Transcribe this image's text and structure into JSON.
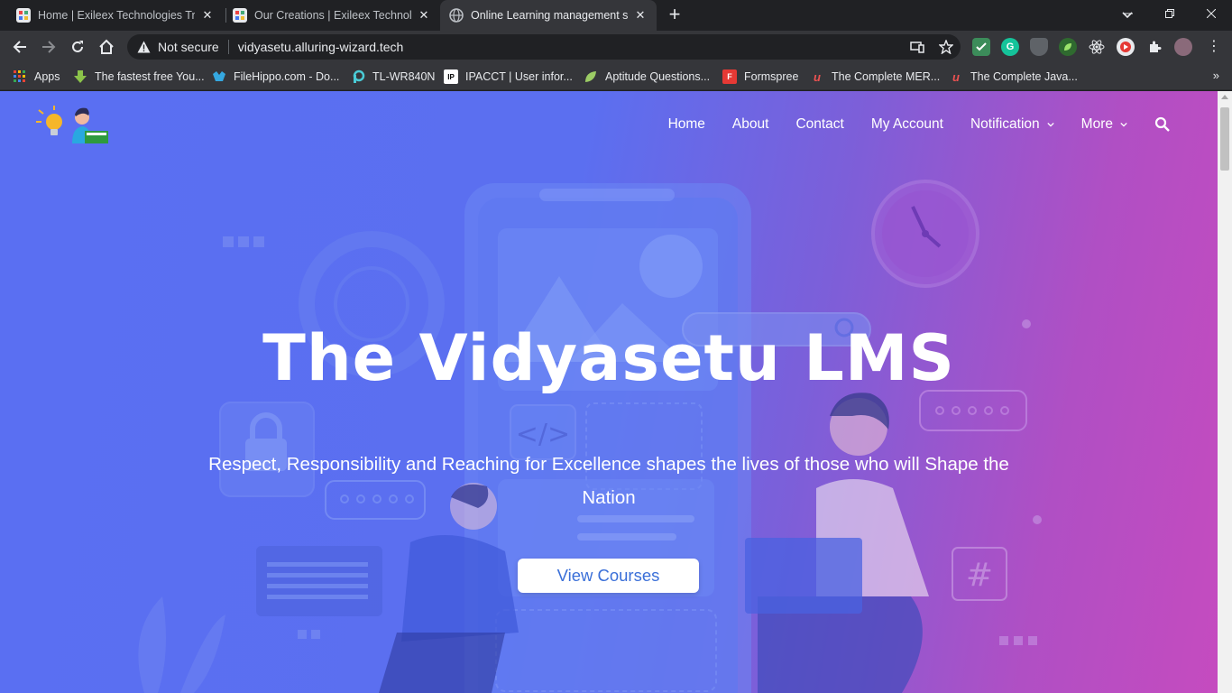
{
  "browser": {
    "tabs": [
      {
        "title": "Home | Exileex Technologies Tripu",
        "favicon": "exileex-favicon-icon",
        "active": false
      },
      {
        "title": "Our Creations | Exileex Technolog",
        "favicon": "exileex-favicon-icon",
        "active": false
      },
      {
        "title": "Online Learning management sys",
        "favicon": "globe-icon",
        "active": true
      }
    ],
    "security_label": "Not secure",
    "url": "vidyasetu.alluring-wizard.tech",
    "bookmarks": [
      {
        "label": "Apps",
        "icon": "apps-grid-icon"
      },
      {
        "label": "The fastest free You...",
        "icon": "download-arrow-icon"
      },
      {
        "label": "FileHippo.com - Do...",
        "icon": "filehippo-icon"
      },
      {
        "label": "TL-WR840N",
        "icon": "tplink-icon"
      },
      {
        "label": "IPACCT | User infor...",
        "icon": "ipacct-icon"
      },
      {
        "label": "Aptitude Questions...",
        "icon": "leaf-icon"
      },
      {
        "label": "Formspree",
        "icon": "formspree-icon"
      },
      {
        "label": "The Complete MER...",
        "icon": "udemy-icon"
      },
      {
        "label": "The Complete Java...",
        "icon": "udemy-icon"
      }
    ]
  },
  "site": {
    "nav": [
      {
        "label": "Home",
        "dropdown": false
      },
      {
        "label": "About",
        "dropdown": false
      },
      {
        "label": "Contact",
        "dropdown": false
      },
      {
        "label": "My Account",
        "dropdown": false
      },
      {
        "label": "Notification",
        "dropdown": true
      },
      {
        "label": "More",
        "dropdown": true
      }
    ],
    "hero": {
      "title": "The Vidyasetu LMS",
      "subtitle": "Respect, Responsibility and Reaching for Excellence shapes the lives of those who will Shape the Nation",
      "cta_label": "View Courses"
    }
  },
  "colors": {
    "gradient_start": "#5a6ff2",
    "gradient_end": "#c54bbf",
    "cta_text": "#3a6fd8"
  }
}
